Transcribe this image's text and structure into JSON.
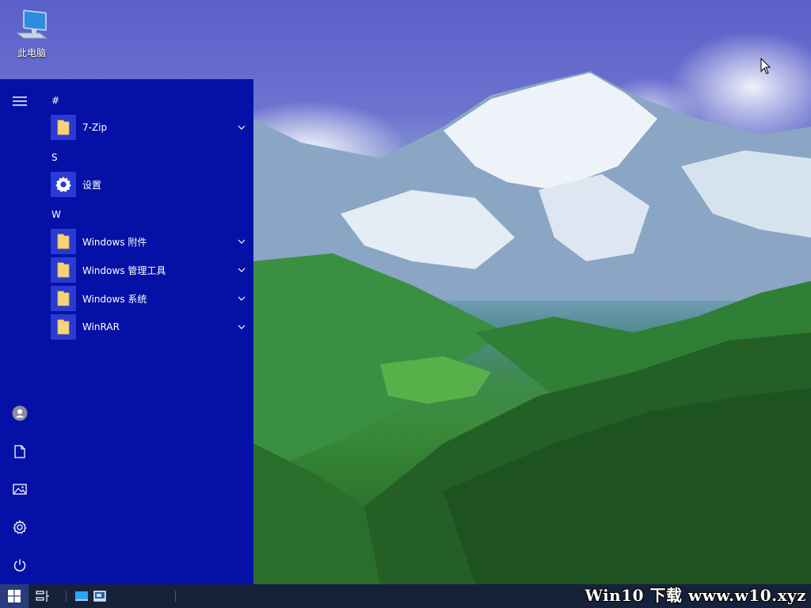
{
  "desktop": {
    "icon_label": "此电脑",
    "icon": "this-pc-icon"
  },
  "start_menu": {
    "background": "#0511a6",
    "tile_color": "#2a3bd4",
    "rail": [
      "hamburger-icon",
      "user-avatar-icon",
      "documents-icon",
      "pictures-icon",
      "settings-icon",
      "power-icon"
    ],
    "groups": [
      {
        "letter": "#",
        "apps": [
          {
            "name": "7-Zip",
            "icon": "folder-icon",
            "expandable": true
          }
        ]
      },
      {
        "letter": "S",
        "apps": [
          {
            "name": "设置",
            "icon": "settings-gear-icon",
            "expandable": false
          }
        ]
      },
      {
        "letter": "W",
        "apps": [
          {
            "name": "Windows 附件",
            "icon": "folder-icon",
            "expandable": true
          },
          {
            "name": "Windows 管理工具",
            "icon": "folder-icon",
            "expandable": true
          },
          {
            "name": "Windows 系统",
            "icon": "folder-icon",
            "expandable": true
          },
          {
            "name": "WinRAR",
            "icon": "folder-icon",
            "expandable": true
          }
        ]
      }
    ]
  },
  "taskbar": {
    "background": "#16213a",
    "buttons": [
      "windows-start-icon",
      "task-view-icon",
      "desktop-app-icon",
      "remote-desktop-icon"
    ],
    "watermark": "Win10 下载 www.w10.xyz"
  }
}
